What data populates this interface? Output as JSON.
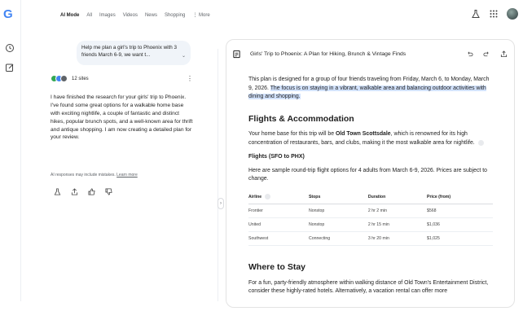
{
  "rail": {
    "logo": "G",
    "history_icon": "history-icon",
    "new_chat_icon": "edit-icon"
  },
  "topbar": {
    "tabs": [
      "AI Mode",
      "All",
      "Images",
      "Videos",
      "News",
      "Shopping",
      "⋮ More"
    ],
    "active_tab": "AI Mode"
  },
  "top_right": {
    "labs_icon": "flask-icon",
    "apps_icon": "apps-grid-icon",
    "avatar": "avatar"
  },
  "chat": {
    "user_prompt": "Help me plan a girl's trip to Phoenix with 3 friends March 6-9, we want t...",
    "sources_label": "12 sites",
    "response": "I have finished the research for your girls' trip to Phoenix. I've found some great options for a walkable home base with exciting nightlife, a couple of fantastic and distinct hikes, popular brunch spots, and a well-known area for thrift and antique shopping. I am now creating a detailed plan for your review.",
    "disclaimer_text": "AI responses may include mistakes.",
    "disclaimer_link": "Learn more"
  },
  "doc": {
    "title": "Girls' Trip to Phoenix: A Plan for Hiking, Brunch & Vintage Finds",
    "intro_plain": "This plan is designed for a group of four friends traveling from Friday, March 6, to Monday, March 9, 2026.",
    "intro_highlight": "The focus is on staying in a vibrant, walkable area and balancing outdoor activities with dining and shopping.",
    "section1_title": "Flights & Accommodation",
    "section1_pre": "Your home base for this trip will be ",
    "section1_bold": "Old Town Scottsdale",
    "section1_post": ", which is renowned for its high concentration of restaurants, bars, and clubs, making it the most walkable area for nightlife.",
    "flights_title": "Flights (SFO to PHX)",
    "flights_intro": "Here are sample round-trip flight options for 4 adults from March 6-9, 2026. Prices are subject to change.",
    "table": {
      "headers": [
        "Airline",
        "Stops",
        "Duration",
        "Price (from)"
      ],
      "rows": [
        [
          "Frontier",
          "Nonstop",
          "2 hr 2 min",
          "$568"
        ],
        [
          "United",
          "Nonstop",
          "2 hr 15 min",
          "$1,036"
        ],
        [
          "Southwest",
          "Connecting",
          "3 hr 20 min",
          "$1,025"
        ]
      ]
    },
    "section2_title": "Where to Stay",
    "section2_text": "For a fun, party-friendly atmosphere within walking distance of Old Town's Entertainment District, consider these highly-rated hotels. Alternatively, a vacation rental can offer more"
  }
}
